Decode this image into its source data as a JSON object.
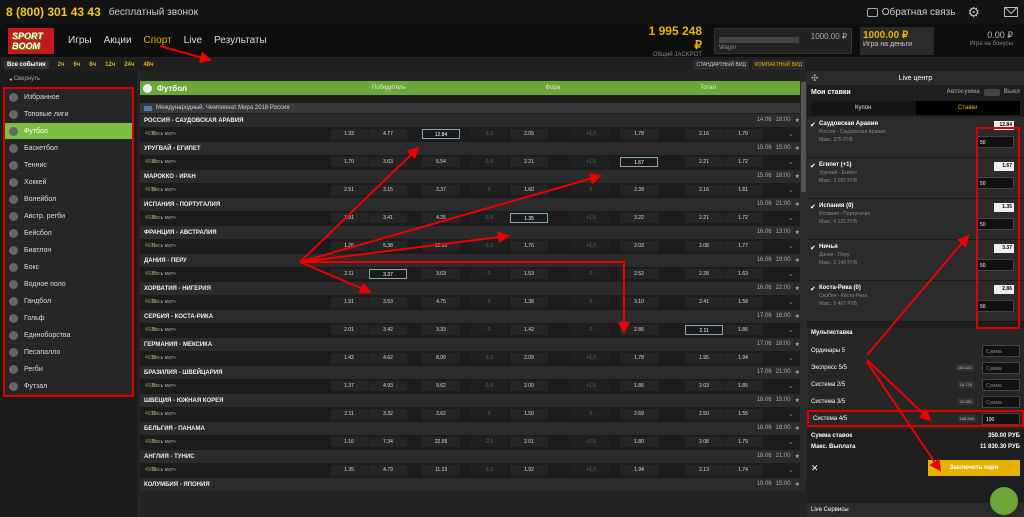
{
  "topbar": {
    "phone": "8 (800) 301 43 43",
    "free_call": "бесплатный звонок",
    "feedback": "Обратная связь"
  },
  "nav": {
    "logo": "SPORT BOOM",
    "links": [
      "Игры",
      "Акции",
      "Спорт",
      "Live",
      "Результаты"
    ],
    "jackpot_value": "1 995 248 ₽",
    "jackpot_label": "Общий JACKPOT",
    "wager_label": "Wager",
    "wager_value": "1000.00 ₽",
    "real_value": "1000.00 ₽",
    "real_label": "Игра на деньги",
    "bonus_value": "0.00 ₽",
    "bonus_label": "Игра на бонусы"
  },
  "filters": [
    "Все события",
    "2ч",
    "6ч",
    "8ч",
    "12ч",
    "24ч",
    "48ч"
  ],
  "views": [
    "СТАНДАРТНЫЙ ВИД",
    "КОМПАКТНЫЙ ВИД"
  ],
  "sidebar": {
    "collapse": "Свернуть",
    "sports": [
      "Избранное",
      "Топовые лиги",
      "Футбол",
      "Баскетбол",
      "Теннис",
      "Хоккей",
      "Волейбол",
      "Австр. регби",
      "Бейсбол",
      "Биатлон",
      "Бокс",
      "Водное поло",
      "Гандбол",
      "Гольф",
      "Единоборства",
      "Песапалло",
      "Регби",
      "Футзал"
    ]
  },
  "main": {
    "header": "Футбол",
    "col_win": "Победитель",
    "col_fora": "Фора",
    "col_total": "Тотал",
    "league": "Международный. Чемпионат Мира 2018 Россия",
    "matches": [
      {
        "title": "РОССИЯ - САУДОВСКАЯ АРАВИЯ",
        "date": "14.06",
        "time": "18:00",
        "id": "4930",
        "type": "Весь матч",
        "odds": [
          "1.33",
          "4.77",
          "12.84",
          "-1.0",
          "2.05",
          "+1.0",
          "1.78",
          "2.16",
          "1.70"
        ],
        "hl": 2
      },
      {
        "title": "УРУГВАЙ - ЕГИПЕТ",
        "date": "15.06",
        "time": "15:00",
        "id": "4910",
        "type": "Весь матч",
        "odds": [
          "1.70",
          "3.63",
          "5.54",
          "-1.0",
          "2.21",
          "+1.0",
          "1.67",
          "2.21",
          "1.72"
        ],
        "hl": 6
      },
      {
        "title": "МАРОККО - ИРАН",
        "date": "15.06",
        "time": "18:00",
        "id": "4919",
        "type": "Весь матч",
        "odds": [
          "2.51",
          "3.15",
          "3.37",
          "0",
          "1.60",
          "0",
          "2.39",
          "2.16",
          "1.81"
        ],
        "hl": -1
      },
      {
        "title": "ИСПАНИЯ - ПОРТУГАЛИЯ",
        "date": "15.06",
        "time": "21:00",
        "id": "4920",
        "type": "Весь матч",
        "odds": [
          "1.91",
          "3.41",
          "4.25",
          "-1.0",
          "1.35",
          "+1.0",
          "3.22",
          "2.21",
          "1.72"
        ],
        "hl": 4
      },
      {
        "title": "ФРАНЦИЯ - АВСТРАЛИЯ",
        "date": "16.06",
        "time": "13:00",
        "id": "4921",
        "type": "Весь матч",
        "odds": [
          "1.26",
          "5.38",
          "12.50",
          "-1.0",
          "1.76",
          "+1.0",
          "2.03",
          "2.08",
          "1.77"
        ],
        "hl": -1
      },
      {
        "title": "ДАНИЯ - ПЕРУ",
        "date": "16.06",
        "time": "19:00",
        "id": "4927",
        "type": "Весь матч",
        "odds": [
          "2.11",
          "3.37",
          "3.63",
          "0",
          "1.53",
          "0",
          "2.52",
          "2.28",
          "1.63"
        ],
        "hl": 1
      },
      {
        "title": "ХОРВАТИЯ - НИГЕРИЯ",
        "date": "16.06",
        "time": "22:00",
        "id": "4922",
        "type": "Весь матч",
        "odds": [
          "1.91",
          "3.53",
          "4.75",
          "0",
          "1.38",
          "0",
          "3.10",
          "2.41",
          "1.58"
        ],
        "hl": -1
      },
      {
        "title": "СЕРБИЯ - КОСТА-РИКА",
        "date": "17.06",
        "time": "16:00",
        "id": "4929",
        "type": "Весь матч",
        "odds": [
          "2.01",
          "3.42",
          "3.33",
          "0",
          "1.42",
          "0",
          "2.86",
          "2.11",
          "1.86"
        ],
        "hl": 7
      },
      {
        "title": "ГЕРМАНИЯ - МЕКСИКА",
        "date": "17.06",
        "time": "18:00",
        "id": "4933",
        "type": "Весь матч",
        "odds": [
          "1.42",
          "4.62",
          "8.00",
          "-1.0",
          "2.09",
          "+1.0",
          "1.78",
          "1.95",
          "1.94"
        ],
        "hl": -1
      },
      {
        "title": "БРАЗИЛИЯ - ШВЕЙЦАРИЯ",
        "date": "17.06",
        "time": "21:00",
        "id": "4931",
        "type": "Весь матч",
        "odds": [
          "1.37",
          "4.93",
          "9.62",
          "-1.0",
          "2.00",
          "+1.0",
          "1.86",
          "2.03",
          "1.85"
        ],
        "hl": -1
      },
      {
        "title": "ШВЕЦИЯ - ЮЖНАЯ КОРЕЯ",
        "date": "18.06",
        "time": "15:00",
        "id": "4932",
        "type": "Весь матч",
        "odds": [
          "2.11",
          "3.32",
          "3.62",
          "0",
          "1.50",
          "0",
          "2.69",
          "2.50",
          "1.55"
        ],
        "hl": -1
      },
      {
        "title": "БЕЛЬГИЯ - ПАНАМА",
        "date": "18.06",
        "time": "18:00",
        "id": "4901",
        "type": "Весь матч",
        "odds": [
          "1.16",
          "7.34",
          "22.99",
          "-2.0",
          "2.01",
          "+2.0",
          "1.80",
          "2.08",
          "1.79"
        ],
        "hl": -1
      },
      {
        "title": "АНГЛИЯ - ТУНИС",
        "date": "18.06",
        "time": "21:00",
        "id": "4902",
        "type": "Весь матч",
        "odds": [
          "1.35",
          "4.79",
          "11.13",
          "-1.0",
          "1.92",
          "+1.0",
          "1.94",
          "2.13",
          "1.74"
        ],
        "hl": -1
      },
      {
        "title": "КОЛУМБИЯ - ЯПОНИЯ",
        "date": "19.06",
        "time": "15:00",
        "id": "",
        "type": "",
        "odds": [],
        "hl": -1
      }
    ]
  },
  "betslip": {
    "live_center": "Live центр",
    "my_bets": "Мои ставки",
    "auto": "Автосумма",
    "auto_state": "Выкл",
    "tabs": [
      "Купон",
      "Ставки"
    ],
    "bets": [
      {
        "title": "Саудовская Аравия",
        "sub": "Россия - Саудовская Аравия",
        "note": "Макс. 375 РУБ",
        "odd": "12.84",
        "amount": "50"
      },
      {
        "title": "Египет (+1)",
        "sub": "Уругвай - Египет",
        "note": "Макс. 3 037 РУБ",
        "odd": "1.67",
        "amount": "50"
      },
      {
        "title": "Испания (0)",
        "sub": "Испания - Португалия",
        "note": "Макс. 6 225 РУБ",
        "odd": "1.35",
        "amount": "50"
      },
      {
        "title": "Ничья",
        "sub": "Дания - Перу",
        "note": "Макс. 2 148 РУБ",
        "odd": "3.37",
        "amount": "50"
      },
      {
        "title": "Коста-Рика (0)",
        "sub": "Сербия - Коста-Рика",
        "note": "Макс. 5 407 РУБ",
        "odd": "2.86",
        "amount": "50"
      }
    ],
    "multi_title": "Мультиставка",
    "systems": [
      {
        "label": "Ординары 5",
        "sub": "Макс. 5 РУБ",
        "k": "",
        "value": "Сумма"
      },
      {
        "label": "Экспресс 5/5",
        "sub": "",
        "k": "281.621",
        "value": "Сумма"
      },
      {
        "label": "Система 2/5",
        "sub": "",
        "k": "14.716",
        "value": "Сумма"
      },
      {
        "label": "Система 3/5",
        "sub": "",
        "k": "22.881",
        "value": "Сумма"
      },
      {
        "label": "Система 4/5",
        "sub": "",
        "k": "188.268",
        "value": "100"
      }
    ],
    "sum_label": "Сумма ставок",
    "sum_value": "350.00 РУБ",
    "max_label": "Макс. Выплата",
    "max_value": "11 830.30 РУБ",
    "submit": "Заключить пари",
    "live_services": "Live Сервисы"
  }
}
